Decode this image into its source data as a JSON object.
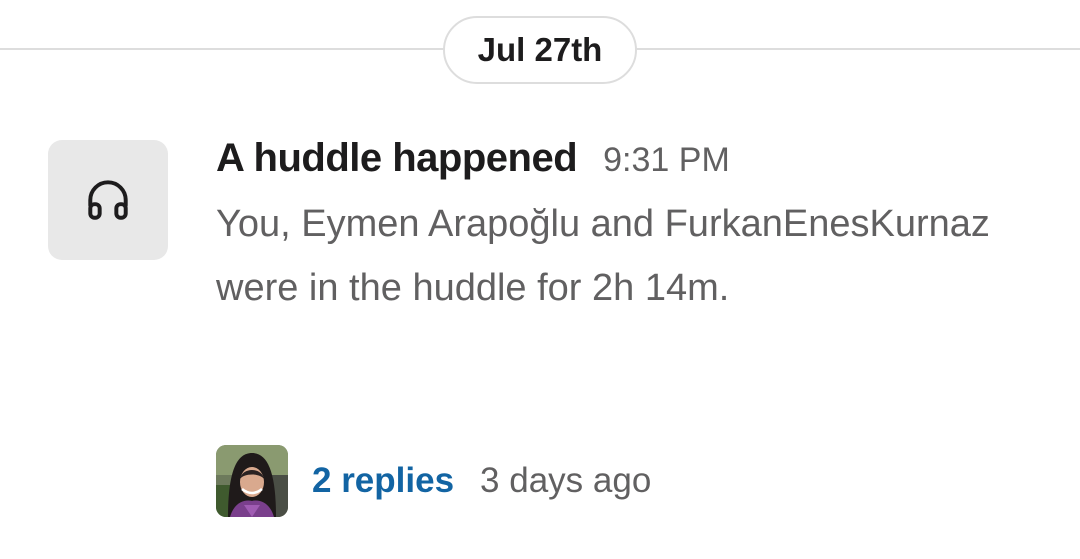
{
  "date_divider": {
    "label": "Jul 27th"
  },
  "message": {
    "icon": "headphones-icon",
    "sender": "A huddle happened",
    "time": "9:31 PM",
    "body": "You, Eymen Arapoğlu and FurkanEnesKurnaz were in the huddle for 2h 14m."
  },
  "thread": {
    "replies_label": "2 replies",
    "last_reply": "3 days ago"
  },
  "colors": {
    "link": "#1264a3",
    "muted_text": "#616061",
    "primary_text": "#1d1c1d",
    "divider": "#dddddd",
    "icon_tile": "#e8e8e8"
  }
}
